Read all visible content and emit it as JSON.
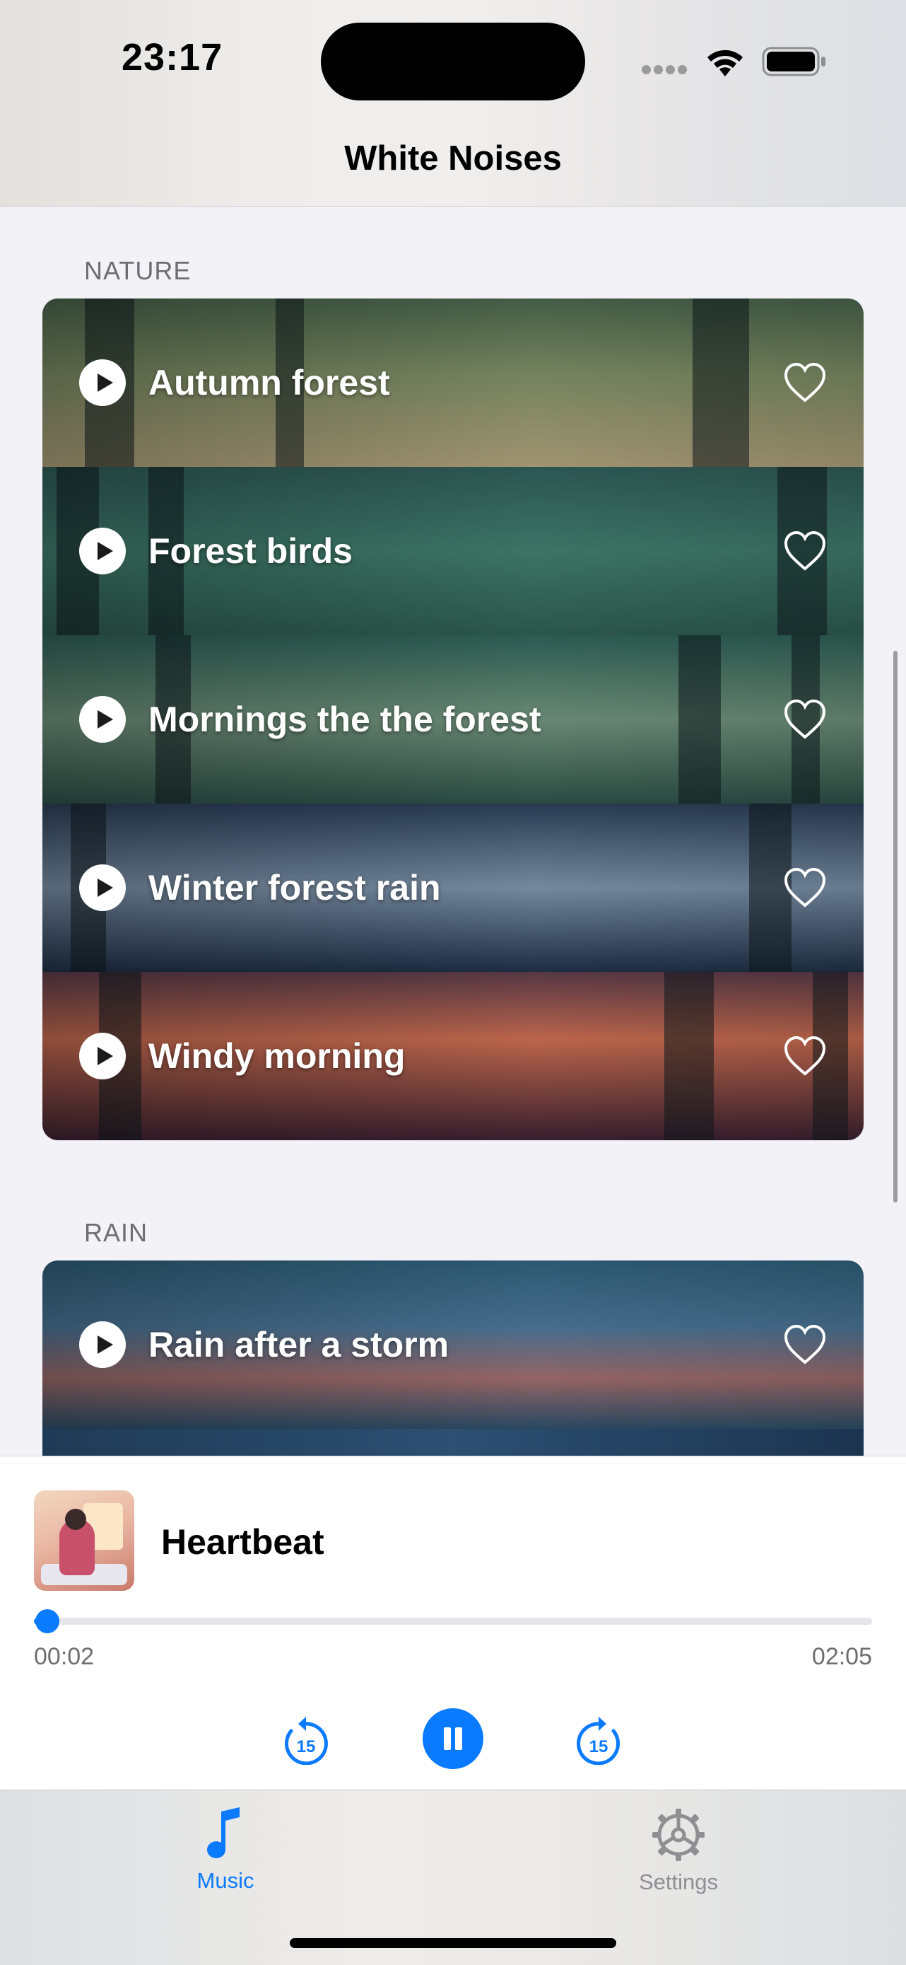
{
  "status_bar": {
    "time": "23:17"
  },
  "nav": {
    "title": "White Noises"
  },
  "sections": [
    {
      "header": "NATURE",
      "items": [
        {
          "title": "Autumn forest"
        },
        {
          "title": "Forest birds"
        },
        {
          "title": "Mornings the the forest"
        },
        {
          "title": "Winter forest rain"
        },
        {
          "title": "Windy morning"
        }
      ]
    },
    {
      "header": "RAIN",
      "items": [
        {
          "title": "Rain after a storm"
        }
      ]
    }
  ],
  "player": {
    "title": "Heartbeat",
    "elapsed": "00:02",
    "total": "02:05",
    "progress_fraction": 0.016,
    "skip_back_seconds": "15",
    "skip_forward_seconds": "15"
  },
  "tabs": [
    {
      "label": "Music",
      "icon": "music-note-icon",
      "selected": true
    },
    {
      "label": "Settings",
      "icon": "gear-icon",
      "selected": false
    }
  ],
  "colors": {
    "accent": "#0a7aff",
    "secondary_text": "#6d6d72"
  }
}
